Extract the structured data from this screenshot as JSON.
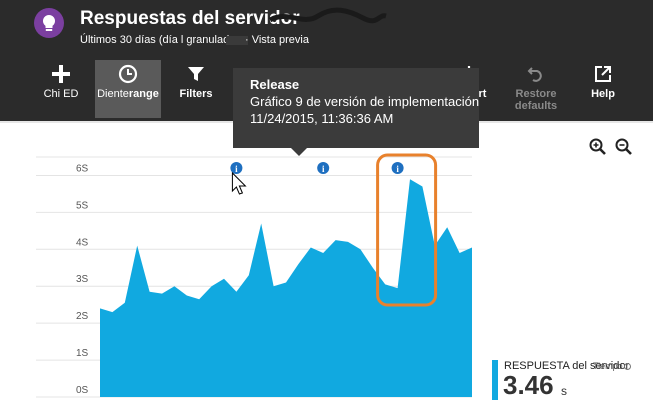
{
  "header": {
    "title": "Respuestas del servidor",
    "subtitle": "Últimos 30 días (día l granulado",
    "preview": "· Vista previa"
  },
  "toolbar": {
    "add_label": "Chi ED",
    "range_label_a": "Diente",
    "range_label_b": "range",
    "filters_label": "Filters",
    "export_label": "Export",
    "restore_label_1": "Restore",
    "restore_label_2": "defaults",
    "help_label": "Help"
  },
  "tooltip": {
    "title": "Release",
    "line1": "Gráfico 9 de versión de implementación",
    "line2": "11/24/2015, 11:36:36 AM"
  },
  "legend": {
    "name": "RESPUESTA del servidor",
    "value": "3.46",
    "unit": "s",
    "extra": "Tiempo"
  },
  "colors": {
    "area": "#11a9e0",
    "highlight": "#e8812c",
    "header_bg": "#2b2b2b",
    "tooltip_bg": "#3b3b3b",
    "marker": "#1e6fc0"
  },
  "icons": [
    "bulb-icon",
    "plus-icon",
    "clock-icon",
    "funnel-icon",
    "download-icon",
    "undo-icon",
    "external-link-icon",
    "zoom-in-icon",
    "zoom-out-icon",
    "info-icon",
    "cursor-icon"
  ],
  "chart_data": {
    "type": "area",
    "yticks": [
      "0S",
      "1S",
      "2S",
      "3S",
      "4S",
      "5S",
      "6S"
    ],
    "ylim": [
      0,
      6.5
    ],
    "values": [
      2.4,
      2.3,
      2.55,
      4.1,
      2.85,
      2.8,
      3.0,
      2.75,
      2.65,
      3.0,
      3.2,
      2.85,
      3.3,
      4.7,
      3.0,
      3.1,
      3.6,
      4.05,
      3.9,
      4.25,
      4.2,
      4.0,
      3.5,
      3.05,
      2.95,
      5.9,
      5.7,
      4.1,
      4.6,
      3.9,
      4.05
    ],
    "release_markers": [
      11,
      18,
      24
    ]
  }
}
